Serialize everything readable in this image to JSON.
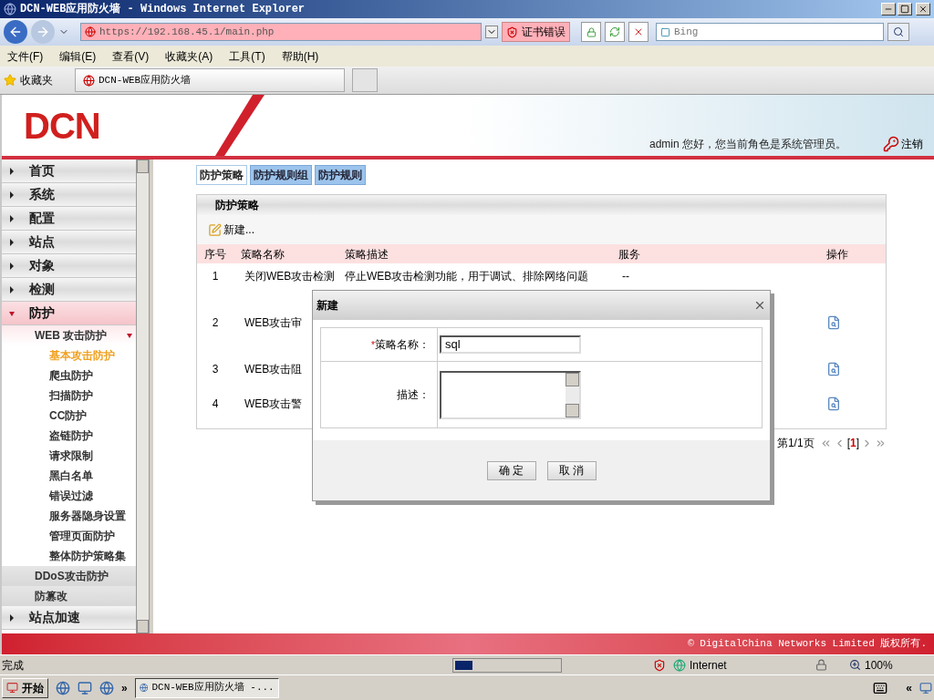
{
  "browser": {
    "title": "DCN-WEB应用防火墙 - Windows Internet Explorer",
    "url": "https://192.168.45.1/main.php",
    "cert_error": "证书错误",
    "search_placeholder": "Bing",
    "menu": [
      "文件(F)",
      "编辑(E)",
      "查看(V)",
      "收藏夹(A)",
      "工具(T)",
      "帮助(H)"
    ],
    "favorites": "收藏夹",
    "tab": "DCN-WEB应用防火墙"
  },
  "header": {
    "logo": "DCN",
    "welcome": "admin 您好，您当前角色是系统管理员。",
    "logout": "注销"
  },
  "sidebar": {
    "items": [
      {
        "label": "首页",
        "expanded": false
      },
      {
        "label": "系统",
        "expanded": false
      },
      {
        "label": "配置",
        "expanded": false
      },
      {
        "label": "站点",
        "expanded": false
      },
      {
        "label": "对象",
        "expanded": false
      },
      {
        "label": "检测",
        "expanded": false
      },
      {
        "label": "防护",
        "expanded": true,
        "children": [
          {
            "label": "WEB 攻击防护",
            "expanded": true,
            "children": [
              {
                "label": "基本攻击防护",
                "selected": true
              },
              {
                "label": "爬虫防护",
                "selected": false
              },
              {
                "label": "扫描防护",
                "selected": false
              },
              {
                "label": "CC防护",
                "selected": false
              },
              {
                "label": "盗链防护",
                "selected": false
              },
              {
                "label": "请求限制",
                "selected": false
              },
              {
                "label": "黑白名单",
                "selected": false
              },
              {
                "label": "错误过滤",
                "selected": false
              },
              {
                "label": "服务器隐身设置",
                "selected": false
              },
              {
                "label": "管理页面防护",
                "selected": false
              },
              {
                "label": "整体防护策略集",
                "selected": false
              }
            ]
          },
          {
            "label": "DDoS攻击防护",
            "expanded": false
          },
          {
            "label": "防篡改",
            "expanded": false
          }
        ]
      },
      {
        "label": "站点加速",
        "expanded": false
      }
    ]
  },
  "tabs": [
    {
      "label": "防护策略",
      "selected": true
    },
    {
      "label": "防护规则组",
      "selected": false
    },
    {
      "label": "防护规则",
      "selected": false
    }
  ],
  "panel": {
    "title": "防护策略",
    "new_button": "新建...",
    "columns": [
      "序号",
      "策略名称",
      "策略描述",
      "服务",
      "操作"
    ],
    "rows": [
      {
        "index": "1",
        "name": "关闭WEB攻击检测",
        "description": "停止WEB攻击检测功能，用于调试、排除网络问题",
        "service": "--",
        "action_icon": false
      },
      {
        "index": "2",
        "name": "WEB攻击审",
        "action_icon": true
      },
      {
        "index": "3",
        "name": "WEB攻击阻",
        "action_icon": true
      },
      {
        "index": "4",
        "name": "WEB攻击警",
        "action_icon": true
      }
    ],
    "pager": {
      "text": "第1/1页",
      "current": "[**1**]"
    }
  },
  "dialog": {
    "title": "新建",
    "fields": [
      {
        "kind": "text",
        "mark": "*",
        "label": "策略名称：",
        "value": "sql"
      },
      {
        "kind": "textarea",
        "label": "描述："
      }
    ],
    "buttons": [
      "确 定",
      "取 消"
    ]
  },
  "footer": "© DigitalChina Networks Limited 版权所有.",
  "status_bar": {
    "text": "完成",
    "level": 0.17,
    "zone": "Internet",
    "zoom": "100%"
  },
  "taskbar": {
    "start": "开始",
    "more": "»",
    "task": "DCN-WEB应用防火墙 -...",
    "tray_more": "«"
  }
}
